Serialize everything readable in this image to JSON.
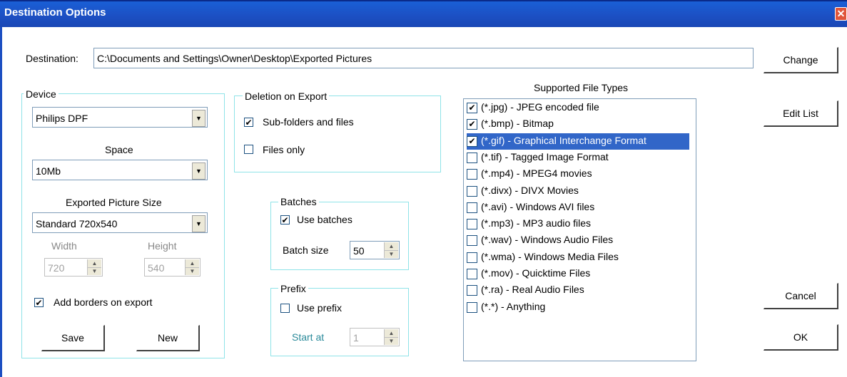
{
  "window": {
    "title": "Destination Options",
    "close": "✕"
  },
  "destination": {
    "label": "Destination:",
    "path": "C:\\Documents and Settings\\Owner\\Desktop\\Exported Pictures",
    "change_label": "Change"
  },
  "device": {
    "legend": "Device",
    "device_value": "Philips DPF",
    "space_label": "Space",
    "space_value": "10Mb",
    "size_label": "Exported Picture Size",
    "size_value": "Standard 720x540",
    "width_label": "Width",
    "width_value": "720",
    "height_label": "Height",
    "height_value": "540",
    "borders_label": "Add borders on export",
    "borders_checked": true,
    "save_label": "Save",
    "new_label": "New"
  },
  "deletion": {
    "legend": "Deletion on Export",
    "subfolders_label": "Sub-folders and files",
    "subfolders_checked": true,
    "files_only_label": "Files only",
    "files_only_checked": false
  },
  "batches": {
    "legend": "Batches",
    "use_label": "Use batches",
    "use_checked": true,
    "size_label": "Batch size",
    "size_value": "50"
  },
  "prefix": {
    "legend": "Prefix",
    "use_label": "Use prefix",
    "use_checked": false,
    "start_label": "Start at",
    "start_value": "1"
  },
  "file_types": {
    "header": "Supported File Types",
    "edit_label": "Edit List",
    "items": [
      {
        "label": "(*.jpg) - JPEG encoded file",
        "checked": true,
        "selected": false
      },
      {
        "label": "(*.bmp) - Bitmap",
        "checked": true,
        "selected": false
      },
      {
        "label": "(*.gif) - Graphical Interchange Format",
        "checked": true,
        "selected": true
      },
      {
        "label": "(*.tif) - Tagged Image Format",
        "checked": false,
        "selected": false
      },
      {
        "label": "(*.mp4) - MPEG4 movies",
        "checked": false,
        "selected": false
      },
      {
        "label": "(*.divx) - DIVX Movies",
        "checked": false,
        "selected": false
      },
      {
        "label": "(*.avi) - Windows AVI files",
        "checked": false,
        "selected": false
      },
      {
        "label": "(*.mp3) - MP3 audio files",
        "checked": false,
        "selected": false
      },
      {
        "label": "(*.wav) - Windows Audio Files",
        "checked": false,
        "selected": false
      },
      {
        "label": "(*.wma) - Windows Media Files",
        "checked": false,
        "selected": false
      },
      {
        "label": "(*.mov) - Quicktime Files",
        "checked": false,
        "selected": false
      },
      {
        "label": "(*.ra) - Real Audio Files",
        "checked": false,
        "selected": false
      },
      {
        "label": "(*.*) - Anything",
        "checked": false,
        "selected": false
      }
    ]
  },
  "buttons": {
    "cancel_label": "Cancel",
    "ok_label": "OK"
  },
  "glyphs": {
    "check": "✔",
    "dropdown": "▼",
    "spin_up": "▲",
    "spin_down": "▼"
  }
}
